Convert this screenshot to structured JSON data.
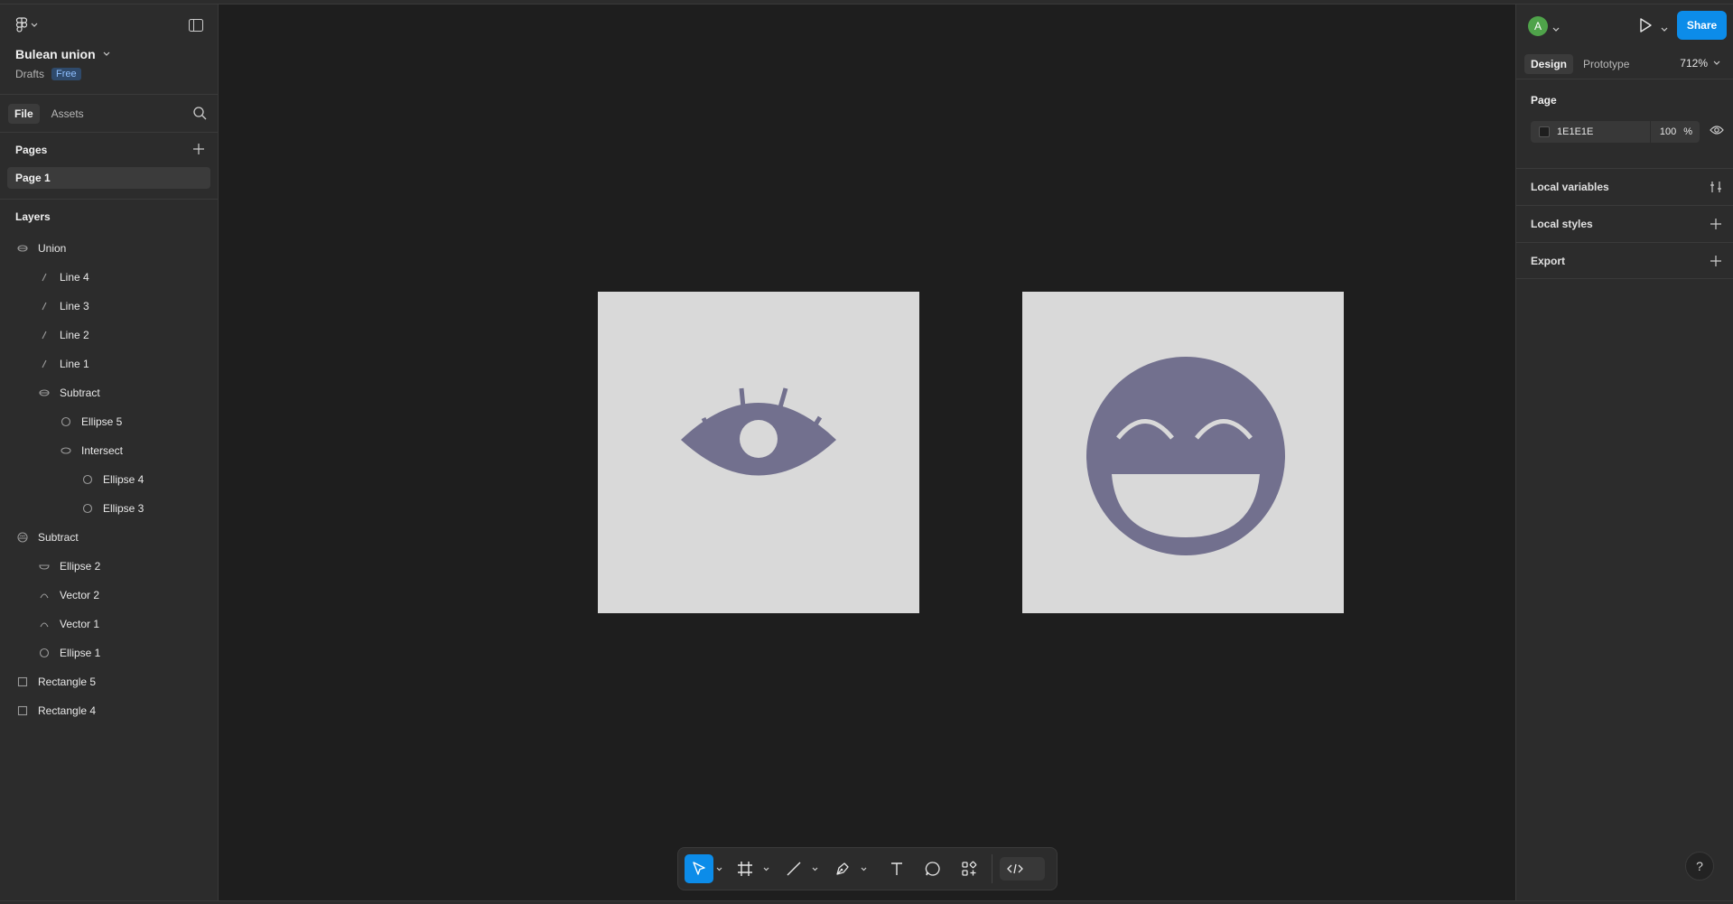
{
  "file": {
    "name": "Bulean union",
    "location": "Drafts",
    "plan_badge": "Free"
  },
  "left_tabs": {
    "file": "File",
    "assets": "Assets"
  },
  "pages": {
    "title": "Pages",
    "items": [
      {
        "label": "Page 1"
      }
    ]
  },
  "layers": {
    "title": "Layers",
    "items": [
      {
        "label": "Union",
        "icon": "union-icon",
        "depth": 0
      },
      {
        "label": "Line 4",
        "icon": "line-icon",
        "depth": 1
      },
      {
        "label": "Line 3",
        "icon": "line-icon",
        "depth": 1
      },
      {
        "label": "Line 2",
        "icon": "line-icon",
        "depth": 1
      },
      {
        "label": "Line 1",
        "icon": "line-icon",
        "depth": 1
      },
      {
        "label": "Subtract",
        "icon": "boolean-icon",
        "depth": 1
      },
      {
        "label": "Ellipse 5",
        "icon": "ellipse-icon",
        "depth": 2
      },
      {
        "label": "Intersect",
        "icon": "intersect-icon",
        "depth": 2
      },
      {
        "label": "Ellipse 4",
        "icon": "ellipse-icon",
        "depth": 3
      },
      {
        "label": "Ellipse 3",
        "icon": "ellipse-icon",
        "depth": 3
      },
      {
        "label": "Subtract",
        "icon": "subtract-icon",
        "depth": 0
      },
      {
        "label": "Ellipse 2",
        "icon": "ellipse-half-icon",
        "depth": 1
      },
      {
        "label": "Vector 2",
        "icon": "vector-icon",
        "depth": 1
      },
      {
        "label": "Vector 1",
        "icon": "vector-icon",
        "depth": 1
      },
      {
        "label": "Ellipse 1",
        "icon": "ellipse-icon",
        "depth": 1
      },
      {
        "label": "Rectangle 5",
        "icon": "rectangle-icon",
        "depth": 0
      },
      {
        "label": "Rectangle 4",
        "icon": "rectangle-icon",
        "depth": 0
      }
    ]
  },
  "right": {
    "avatar_letter": "A",
    "share_label": "Share",
    "tab_design": "Design",
    "tab_prototype": "Prototype",
    "zoom": "712%",
    "page_section": "Page",
    "page_color_hex": "1E1E1E",
    "page_opacity": "100",
    "percent": "%",
    "local_variables": "Local variables",
    "local_styles": "Local styles",
    "export": "Export"
  },
  "help_label": "?",
  "colors": {
    "accent": "#0c8ce9",
    "canvas": "#1e1e1e",
    "panel": "#2c2c2c",
    "frame_fill": "#d9d9d9",
    "shape_fill": "#72708e",
    "avatar": "#4fa34a"
  }
}
